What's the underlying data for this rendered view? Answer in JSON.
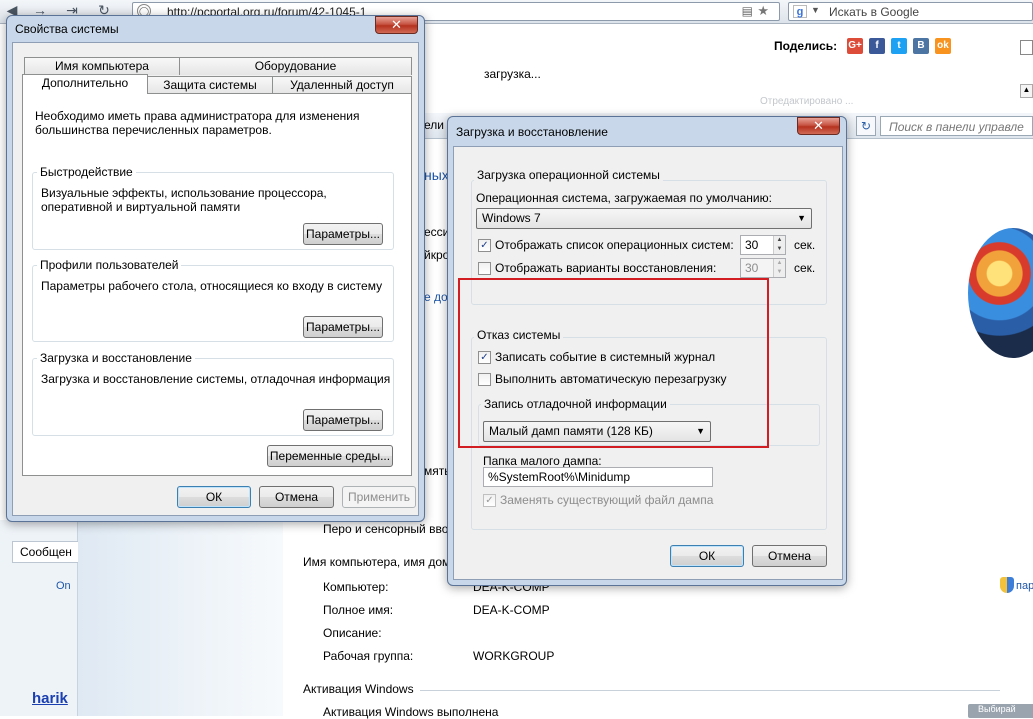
{
  "browser": {
    "url": "http://pcportal.org.ru/forum/42-1045-1",
    "search_placeholder": "Искать в Google",
    "search_engine_icon": "google-g-icon"
  },
  "page": {
    "share_label": "Поделись:",
    "share_icons": [
      "G+",
      "f",
      "t",
      "B",
      "ok"
    ],
    "share_colors": [
      "#dd4b39",
      "#3b5998",
      "#1da1f2",
      "#4c75a3",
      "#f7931e"
    ],
    "zagruzka_text": "загрузка...",
    "blurred_header": "Отредактировано ...",
    "cp_search_placeholder": "Поиск в панели управле",
    "cp_partial_left": "ели упр",
    "cp_link_fragment": "ных",
    "frag_1": "ессио",
    "frag_2": "йкро",
    "frag_3": "е доп",
    "frag_4": "мять",
    "pen_touch": "Перо и сенсорный вво",
    "computer_name_section": "Имя компьютера, имя дом",
    "rows": [
      {
        "label": "Компьютер:",
        "value": "DEA-K-COMP"
      },
      {
        "label": "Полное имя:",
        "value": "DEA-K-COMP"
      },
      {
        "label": "Описание:",
        "value": ""
      },
      {
        "label": "Рабочая группа:",
        "value": "WORKGROUP"
      }
    ],
    "activation_section": "Активация Windows",
    "activation_status": "Активация Windows выполнена",
    "soobsh_button": "Сообщен",
    "on_link": "On",
    "harik_link": "harik",
    "pa_fragment": "пар",
    "vybor_fragment": "Выбирай"
  },
  "sys_props": {
    "title": "Свойства системы",
    "tabs_row1": [
      "Имя компьютера",
      "Оборудование"
    ],
    "tabs_row2": [
      "Дополнительно",
      "Защита системы",
      "Удаленный доступ"
    ],
    "admin_note": "Необходимо иметь права администратора для изменения большинства перечисленных параметров.",
    "groups": [
      {
        "title": "Быстродействие",
        "desc": "Визуальные эффекты, использование процессора, оперативной и виртуальной памяти",
        "button": "Параметры..."
      },
      {
        "title": "Профили пользователей",
        "desc": "Параметры рабочего стола, относящиеся ко входу в систему",
        "button": "Параметры..."
      },
      {
        "title": "Загрузка и восстановление",
        "desc": "Загрузка и восстановление системы, отладочная информация",
        "button": "Параметры..."
      }
    ],
    "env_button": "Переменные среды...",
    "ok": "ОК",
    "cancel": "Отмена",
    "apply": "Применить"
  },
  "boot": {
    "title": "Загрузка и восстановление",
    "os_group_title": "Загрузка операционной системы",
    "default_os_label": "Операционная система, загружаемая по умолчанию:",
    "default_os_value": "Windows 7",
    "show_list_label": "Отображать список операционных систем:",
    "show_list_checked": true,
    "show_list_seconds": "30",
    "show_recovery_label": "Отображать варианты восстановления:",
    "show_recovery_checked": false,
    "show_recovery_seconds": "30",
    "sec_unit": "сек.",
    "failure_group_title": "Отказ системы",
    "write_event_label": "Записать событие в системный журнал",
    "write_event_checked": true,
    "auto_restart_label": "Выполнить автоматическую перезагрузку",
    "auto_restart_checked": false,
    "debug_group_title": "Запись отладочной информации",
    "dump_type": "Малый дамп памяти (128 КБ)",
    "dump_folder_label": "Папка малого дампа:",
    "dump_folder_value": "%SystemRoot%\\Minidump",
    "overwrite_label": "Заменять существующий файл дампа",
    "overwrite_checked": true,
    "ok": "ОК",
    "cancel": "Отмена",
    "highlight_color": "#d21d22"
  }
}
